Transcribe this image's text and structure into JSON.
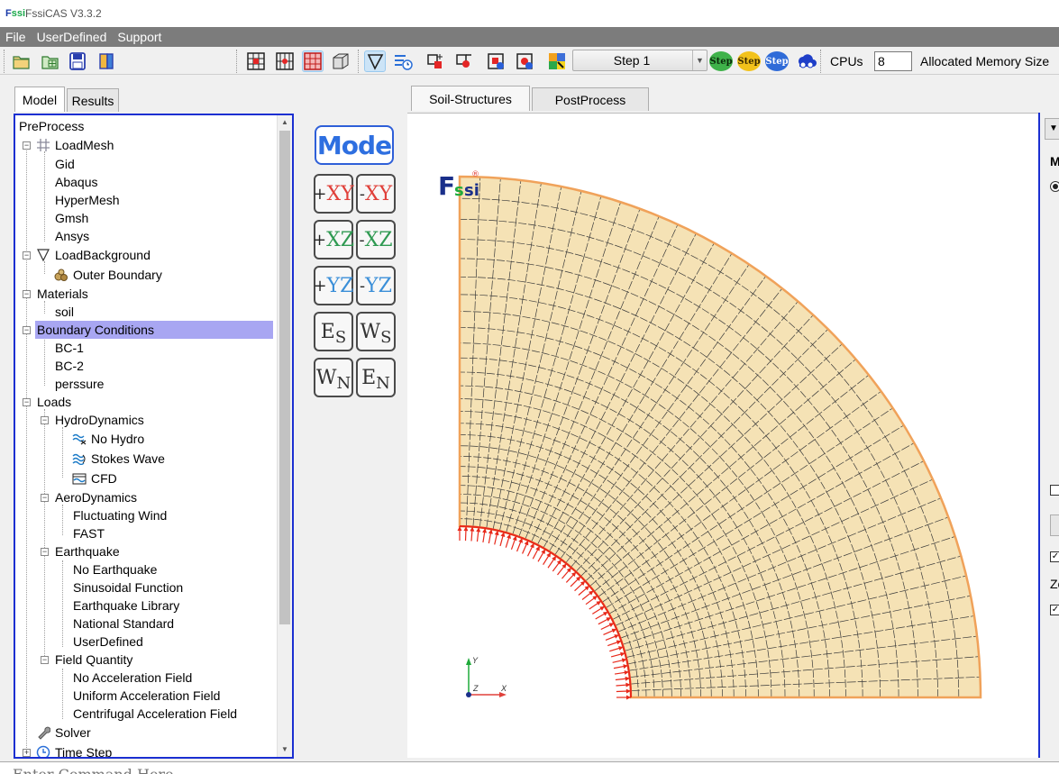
{
  "window": {
    "title": "FssiCAS V3.3.2",
    "logo_main": "F",
    "logo_sub": "ssi"
  },
  "menu": [
    "File",
    "UserDefined",
    "Support"
  ],
  "toolbar": {
    "step_value": "Step 1",
    "step_icon_label": "Step",
    "cpus_label": "CPUs",
    "cpus_value": "8",
    "memory_label": "Allocated Memory Size"
  },
  "left_tabs": [
    "Model",
    "Results"
  ],
  "canvas_tabs": [
    "Soil-Structures",
    "PostProcess"
  ],
  "tree": {
    "root": "PreProcess",
    "items": [
      {
        "label": "LoadMesh"
      },
      {
        "label": "Gid"
      },
      {
        "label": "Abaqus"
      },
      {
        "label": "HyperMesh"
      },
      {
        "label": "Gmsh"
      },
      {
        "label": "Ansys"
      },
      {
        "label": "LoadBackground"
      },
      {
        "label": "Outer Boundary"
      },
      {
        "label": "Materials"
      },
      {
        "label": "soil"
      },
      {
        "label": "Boundary Conditions"
      },
      {
        "label": "BC-1"
      },
      {
        "label": "BC-2"
      },
      {
        "label": "perssure"
      },
      {
        "label": "Loads"
      },
      {
        "label": "HydroDynamics"
      },
      {
        "label": "No Hydro"
      },
      {
        "label": "Stokes Wave"
      },
      {
        "label": "CFD"
      },
      {
        "label": "AeroDynamics"
      },
      {
        "label": "Fluctuating Wind"
      },
      {
        "label": "FAST"
      },
      {
        "label": "Earthquake"
      },
      {
        "label": "No Earthquake"
      },
      {
        "label": "Sinusoidal Function"
      },
      {
        "label": "Earthquake Library"
      },
      {
        "label": "National Standard"
      },
      {
        "label": "UserDefined"
      },
      {
        "label": "Field Quantity"
      },
      {
        "label": "No Acceleration Field"
      },
      {
        "label": "Uniform Acceleration Field"
      },
      {
        "label": "Centrifugal Acceleration Field"
      },
      {
        "label": "Solver"
      },
      {
        "label": "Time Step"
      }
    ]
  },
  "view_buttons": {
    "mode_label": "Mode",
    "plus_xy": {
      "sign": "+",
      "axes": "XY"
    },
    "minus_xy": {
      "sign": "-",
      "axes": "XY"
    },
    "plus_xz": {
      "sign": "+",
      "axes": "XZ"
    },
    "minus_xz": {
      "sign": "-",
      "axes": "XZ"
    },
    "plus_yz": {
      "sign": "+",
      "axes": "YZ"
    },
    "minus_yz": {
      "sign": "-",
      "axes": "YZ"
    },
    "es": {
      "a": "E",
      "b": "S"
    },
    "ws": {
      "a": "W",
      "b": "S"
    },
    "wn": {
      "a": "W",
      "b": "N"
    },
    "en": {
      "a": "E",
      "b": "N"
    },
    "colors": {
      "xy": "#e0403a",
      "xz": "#2f9a52",
      "yz": "#3b8fd8"
    }
  },
  "canvas": {
    "logo_f": "F",
    "logo_s": "s",
    "logo_si": "si",
    "logo_mark": "®",
    "axis_y": "Y",
    "axis_x": "X",
    "axis_z": "Z",
    "mesh_fill": "#f5e2b5",
    "mesh_border": "#f0a25a",
    "load_arrow_color": "#e8291b"
  },
  "right_panel": {
    "letter_m": "M",
    "letter_z": "Ze"
  },
  "command": {
    "placeholder": "Enter Command Here"
  }
}
